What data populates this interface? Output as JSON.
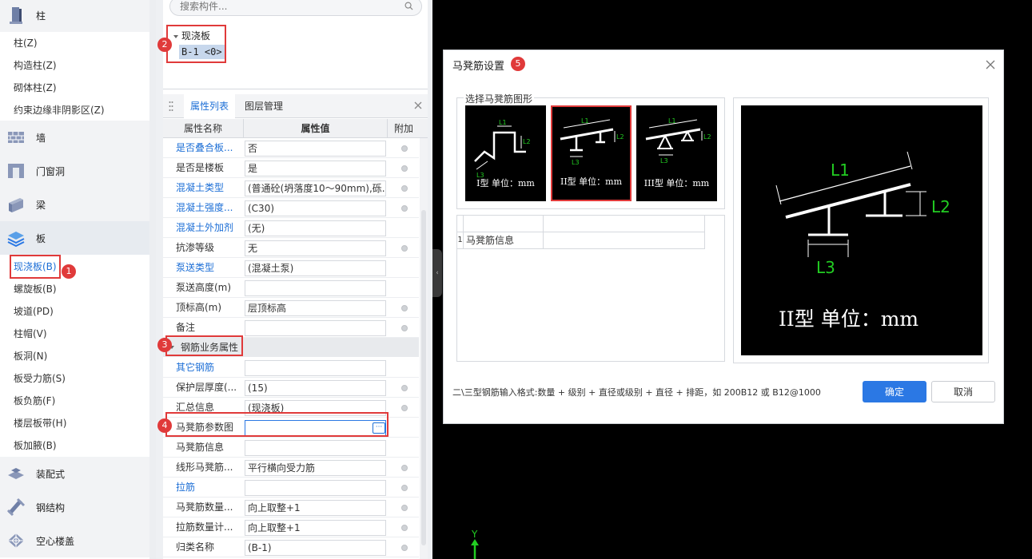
{
  "categories": {
    "groups": [
      {
        "label": "柱",
        "icon": "column-icon"
      },
      {
        "label": "墙",
        "icon": "wall-icon"
      },
      {
        "label": "门窗洞",
        "icon": "door-window-icon"
      },
      {
        "label": "梁",
        "icon": "beam-icon"
      },
      {
        "label": "板",
        "icon": "slab-icon"
      },
      {
        "label": "装配式",
        "icon": "prefab-icon"
      },
      {
        "label": "钢结构",
        "icon": "steel-structure-icon"
      },
      {
        "label": "空心楼盖",
        "icon": "hollow-floor-icon"
      }
    ],
    "column_items": [
      "柱(Z)",
      "构造柱(Z)",
      "砌体柱(Z)",
      "约束边缘非阴影区(Z)"
    ],
    "slab_items": [
      "现浇板(B)",
      "螺旋板(B)",
      "坡道(PD)",
      "柱帽(V)",
      "板洞(N)",
      "板受力筋(S)",
      "板负筋(F)",
      "楼层板带(H)",
      "板加腋(B)"
    ]
  },
  "search": {
    "placeholder": "搜索构件..."
  },
  "tree": {
    "node": "现浇板",
    "leaf": "B-1 <0>"
  },
  "tabs": {
    "properties": "属性列表",
    "layers": "图层管理"
  },
  "prop_header": {
    "name": "属性名称",
    "value": "属性值",
    "extra": "附加"
  },
  "props_basic": [
    {
      "name": "是否叠合板...",
      "value": "否",
      "link": true,
      "dot": true
    },
    {
      "name": "是否是楼板",
      "value": "是",
      "link": false,
      "dot": true
    },
    {
      "name": "混凝土类型",
      "value": "(普通砼(坍落度10～90mm),砾...",
      "link": true,
      "dot": true
    },
    {
      "name": "混凝土强度...",
      "value": "(C30)",
      "link": true,
      "dot": true
    },
    {
      "name": "混凝土外加剂",
      "value": "(无)",
      "link": true,
      "dot": false
    },
    {
      "name": "抗渗等级",
      "value": "无",
      "link": false,
      "dot": true
    },
    {
      "name": "泵送类型",
      "value": "(混凝土泵)",
      "link": true,
      "dot": false
    },
    {
      "name": "泵送高度(m)",
      "value": "",
      "link": false,
      "dot": false
    },
    {
      "name": "顶标高(m)",
      "value": "层顶标高",
      "link": false,
      "dot": true
    },
    {
      "name": "备注",
      "value": "",
      "link": false,
      "dot": true
    }
  ],
  "section_rebar": "钢筋业务属性",
  "props_rebar": [
    {
      "name": "其它钢筋",
      "value": "",
      "link": true,
      "dot": false
    },
    {
      "name": "保护层厚度(...",
      "value": "(15)",
      "link": false,
      "dot": true
    },
    {
      "name": "汇总信息",
      "value": "(现浇板)",
      "link": false,
      "dot": true
    },
    {
      "name": "马凳筋参数图",
      "value": "",
      "link": false,
      "dot": false,
      "editing": true
    },
    {
      "name": "马凳筋信息",
      "value": "",
      "link": false,
      "dot": false
    },
    {
      "name": "线形马凳筋...",
      "value": "平行横向受力筋",
      "link": false,
      "dot": true
    },
    {
      "name": "拉筋",
      "value": "",
      "link": true,
      "dot": true
    },
    {
      "name": "马凳筋数量...",
      "value": "向上取整+1",
      "link": false,
      "dot": true
    },
    {
      "name": "拉筋数量计...",
      "value": "向上取整+1",
      "link": false,
      "dot": true
    },
    {
      "name": "归类名称",
      "value": "(B-1)",
      "link": false,
      "dot": true
    }
  ],
  "ellipsis": "···",
  "badges": [
    "1",
    "2",
    "3",
    "4",
    "5"
  ],
  "canvas": {
    "axis_label": "Y"
  },
  "dialog": {
    "title": "马凳筋设置",
    "group_legend": "选择马凳筋图形",
    "shapes": [
      {
        "caption": "I型 单位：mm",
        "l1": "L1",
        "l2": "L2",
        "l3": "L3"
      },
      {
        "caption": "II型 单位：mm",
        "l1": "L1",
        "l2": "L2",
        "l3": "L3"
      },
      {
        "caption": "III型 单位：mm",
        "l1": "L1",
        "l2": "L2",
        "l3": "L3"
      }
    ],
    "table": {
      "row_num": "1",
      "row_label": "马凳筋信息",
      "row_value": ""
    },
    "preview": {
      "caption": "II型 单位：mm",
      "l1": "L1",
      "l2": "L2",
      "l3": "L3"
    },
    "hint": "二\\三型钢筋输入格式:数量 + 级别 + 直径或级别 + 直径 + 排距，如 200B12 或 B12@1000",
    "ok": "确定",
    "cancel": "取消"
  },
  "colors": {
    "accent": "#2b78e4",
    "highlight": "#e03a3a",
    "dim_green": "#22cc22"
  }
}
